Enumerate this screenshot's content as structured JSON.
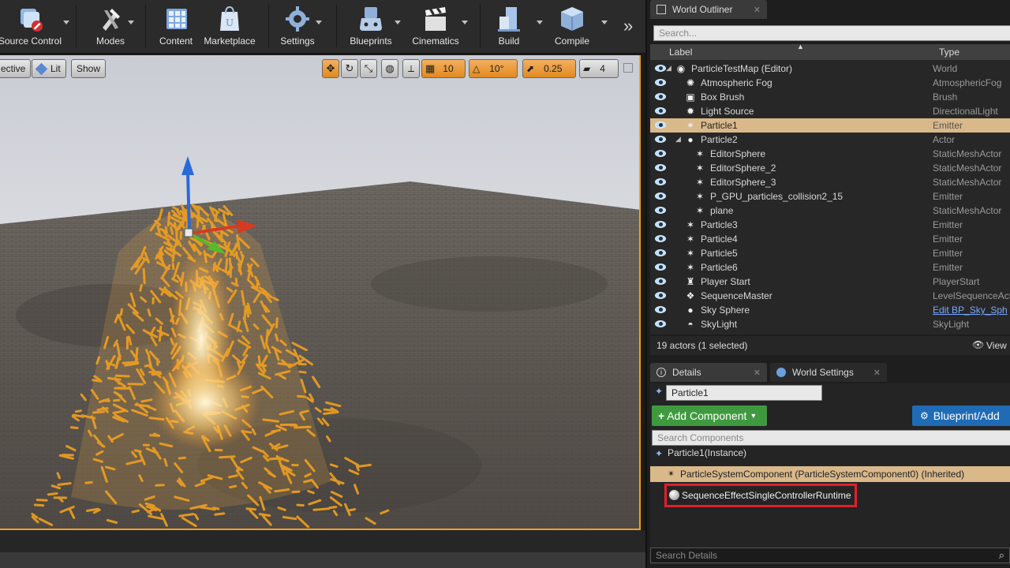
{
  "toolbar": {
    "buttons": [
      {
        "label": "Source Control",
        "icon": "source-control-icon"
      },
      {
        "label": "Modes",
        "icon": "modes-icon"
      },
      {
        "label": "Content",
        "icon": "content-icon"
      },
      {
        "label": "Marketplace",
        "icon": "marketplace-icon"
      },
      {
        "label": "Settings",
        "icon": "settings-icon"
      },
      {
        "label": "Blueprints",
        "icon": "blueprints-icon"
      },
      {
        "label": "Cinematics",
        "icon": "cinematics-icon"
      },
      {
        "label": "Build",
        "icon": "build-icon"
      },
      {
        "label": "Compile",
        "icon": "compile-icon"
      }
    ],
    "more": "»"
  },
  "viewport": {
    "view_mode": "ective",
    "lit": "Lit",
    "show": "Show",
    "grid_snap": "10",
    "rotation_snap": "10°",
    "scale_snap": "0.25",
    "camera_speed": "4",
    "colors": {
      "selection": "#f0a020",
      "floor": "#5a5550",
      "sky": "#e6e8ec"
    }
  },
  "outliner": {
    "tab": "World Outliner",
    "search_placeholder": "Search...",
    "col_label": "Label",
    "col_type": "Type",
    "rows": [
      {
        "label": "ParticleTestMap (Editor)",
        "type": "World",
        "icon": "world-icon",
        "depth": 0,
        "arrow": "◢"
      },
      {
        "label": "Atmospheric Fog",
        "type": "AtmosphericFog",
        "icon": "fog-icon",
        "depth": 1
      },
      {
        "label": "Box Brush",
        "type": "Brush",
        "icon": "brush-icon",
        "depth": 1
      },
      {
        "label": "Light Source",
        "type": "DirectionalLight",
        "icon": "light-icon",
        "depth": 1
      },
      {
        "label": "Particle1",
        "type": "Emitter",
        "icon": "emitter-icon",
        "depth": 1,
        "selected": true
      },
      {
        "label": "Particle2",
        "type": "Actor",
        "icon": "actor-icon",
        "depth": 1,
        "arrow": "◢"
      },
      {
        "label": "EditorSphere",
        "type": "StaticMeshActor",
        "icon": "mesh-icon",
        "depth": 2
      },
      {
        "label": "EditorSphere_2",
        "type": "StaticMeshActor",
        "icon": "mesh-icon",
        "depth": 2
      },
      {
        "label": "EditorSphere_3",
        "type": "StaticMeshActor",
        "icon": "mesh-icon",
        "depth": 2
      },
      {
        "label": "P_GPU_particles_collision2_15",
        "type": "Emitter",
        "icon": "emitter-icon",
        "depth": 2
      },
      {
        "label": "plane",
        "type": "StaticMeshActor",
        "icon": "mesh-icon",
        "depth": 2
      },
      {
        "label": "Particle3",
        "type": "Emitter",
        "icon": "emitter-icon",
        "depth": 1
      },
      {
        "label": "Particle4",
        "type": "Emitter",
        "icon": "emitter-icon",
        "depth": 1
      },
      {
        "label": "Particle5",
        "type": "Emitter",
        "icon": "emitter-icon",
        "depth": 1
      },
      {
        "label": "Particle6",
        "type": "Emitter",
        "icon": "emitter-icon",
        "depth": 1
      },
      {
        "label": "Player Start",
        "type": "PlayerStart",
        "icon": "player-start-icon",
        "depth": 1
      },
      {
        "label": "SequenceMaster",
        "type": "LevelSequenceAct",
        "icon": "sequence-icon",
        "depth": 1
      },
      {
        "label": "Sky Sphere",
        "type": "Edit BP_Sky_Sph",
        "icon": "sphere-icon",
        "depth": 1,
        "link": true
      },
      {
        "label": "SkyLight",
        "type": "SkyLight",
        "icon": "skylight-icon",
        "depth": 1
      }
    ],
    "footer_count": "19 actors (1 selected)",
    "footer_view": "View"
  },
  "details": {
    "tab": "Details",
    "tab2": "World Settings",
    "name_value": "Particle1",
    "add_component": "Add Component",
    "blueprint_add": "Blueprint/Add",
    "search_components": "Search Components",
    "instance": "Particle1(Instance)",
    "component": "ParticleSystemComponent (ParticleSystemComponent0) (Inherited)",
    "sequence": "SequenceEffectSingleControllerRuntime",
    "search_details": "Search Details"
  }
}
